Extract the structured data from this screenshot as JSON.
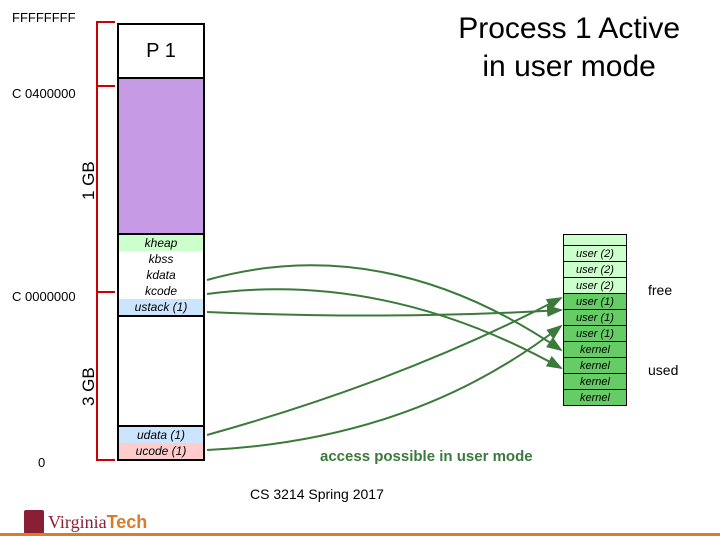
{
  "title_l1": "Process 1 Active",
  "title_l2": "in user mode",
  "addr_ffff": "FFFFFFFF",
  "addr_c04": "C 0400000",
  "addr_c00": "C 0000000",
  "addr_0": "0",
  "p1": "P 1",
  "gb1": "1 GB",
  "gb3": "3 GB",
  "segs_top": [
    "kheap",
    "kbss",
    "kdata",
    "kcode",
    "ustack (1)"
  ],
  "segs_bot": [
    "udata (1)",
    "ucode (1)"
  ],
  "phys": [
    {
      "label": "user (2)",
      "cls": "phys-free"
    },
    {
      "label": "user (2)",
      "cls": "phys-free"
    },
    {
      "label": "user (2)",
      "cls": "phys-free"
    },
    {
      "label": "user (1)",
      "cls": "phys-used"
    },
    {
      "label": "user (1)",
      "cls": "phys-used"
    },
    {
      "label": "user (1)",
      "cls": "phys-used"
    },
    {
      "label": "kernel",
      "cls": "phys-used"
    },
    {
      "label": "kernel",
      "cls": "phys-used"
    },
    {
      "label": "kernel",
      "cls": "phys-used"
    },
    {
      "label": "kernel",
      "cls": "phys-used"
    }
  ],
  "legend_free": "free",
  "legend_used": "used",
  "access": "access possible in user mode",
  "footer": "CS 3214 Spring 2017",
  "logo_text": "Virginia",
  "logo_tech": "Tech"
}
